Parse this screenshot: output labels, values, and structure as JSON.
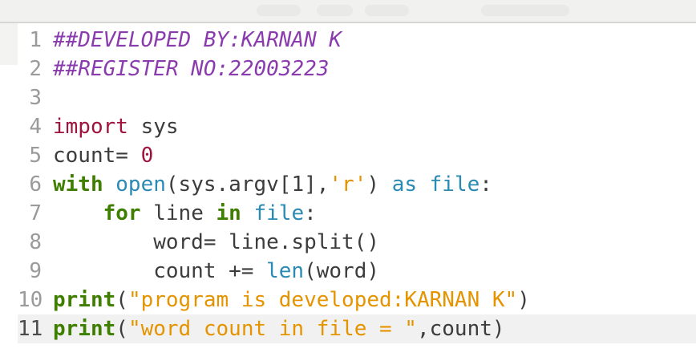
{
  "editor": {
    "lines": [
      {
        "number": "1",
        "tokens": [
          {
            "type": "comment",
            "text": "##DEVELOPED BY:KARNAN K"
          }
        ]
      },
      {
        "number": "2",
        "tokens": [
          {
            "type": "comment",
            "text": "##REGISTER NO:22003223"
          }
        ]
      },
      {
        "number": "3",
        "tokens": []
      },
      {
        "number": "4",
        "tokens": [
          {
            "type": "keyword",
            "text": "import"
          },
          {
            "type": "plain",
            "text": " sys"
          }
        ]
      },
      {
        "number": "5",
        "tokens": [
          {
            "type": "plain",
            "text": "count= "
          },
          {
            "type": "number",
            "text": "0"
          }
        ]
      },
      {
        "number": "6",
        "tokens": [
          {
            "type": "flow",
            "text": "with"
          },
          {
            "type": "plain",
            "text": " "
          },
          {
            "type": "builtin",
            "text": "open"
          },
          {
            "type": "plain",
            "text": "(sys.argv[1],"
          },
          {
            "type": "string",
            "text": "'r'"
          },
          {
            "type": "plain",
            "text": ") "
          },
          {
            "type": "builtin",
            "text": "as"
          },
          {
            "type": "plain",
            "text": " "
          },
          {
            "type": "builtin",
            "text": "file"
          },
          {
            "type": "plain",
            "text": ":"
          }
        ]
      },
      {
        "number": "7",
        "tokens": [
          {
            "type": "plain",
            "text": "    "
          },
          {
            "type": "flow",
            "text": "for"
          },
          {
            "type": "plain",
            "text": " line "
          },
          {
            "type": "flow",
            "text": "in"
          },
          {
            "type": "plain",
            "text": " "
          },
          {
            "type": "builtin",
            "text": "file"
          },
          {
            "type": "plain",
            "text": ":"
          }
        ]
      },
      {
        "number": "8",
        "tokens": [
          {
            "type": "plain",
            "text": "        word= line.split()"
          }
        ]
      },
      {
        "number": "9",
        "tokens": [
          {
            "type": "plain",
            "text": "        count += "
          },
          {
            "type": "builtin",
            "text": "len"
          },
          {
            "type": "plain",
            "text": "(word)"
          }
        ]
      },
      {
        "number": "10",
        "tokens": [
          {
            "type": "flow",
            "text": "print"
          },
          {
            "type": "plain",
            "text": "("
          },
          {
            "type": "string",
            "text": "\"program is developed:KARNAN K\""
          },
          {
            "type": "plain",
            "text": ")"
          }
        ]
      },
      {
        "number": "11",
        "current": true,
        "tokens": [
          {
            "type": "flow",
            "text": "print"
          },
          {
            "type": "plain",
            "text": "("
          },
          {
            "type": "string",
            "text": "\"word count in file = \""
          },
          {
            "type": "plain",
            "text": ",count)"
          }
        ]
      }
    ]
  }
}
